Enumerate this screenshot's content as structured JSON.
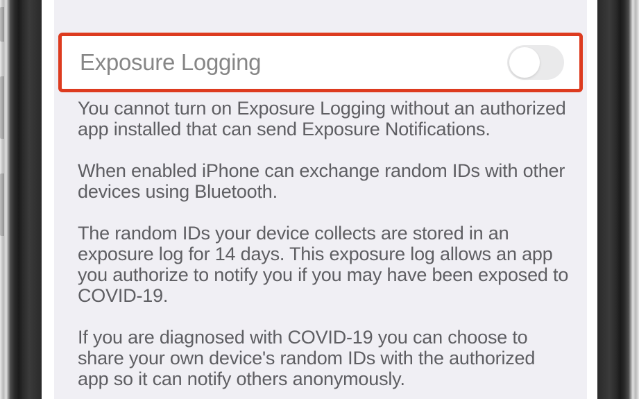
{
  "setting": {
    "label": "Exposure Logging",
    "toggle_state": "off"
  },
  "description": {
    "p1": "You cannot turn on Exposure Logging without an authorized app installed that can send Exposure Notifications.",
    "p2": "When enabled iPhone can exchange random IDs with other devices using Bluetooth.",
    "p3": "The random IDs your device collects are stored in an exposure log for 14 days. This exposure log allows an app you authorize to notify you if you may have been exposed to COVID-19.",
    "p4": "If you are diagnosed with COVID-19 you can choose to share your own device's random IDs with the authorized app so it can notify others anonymously."
  },
  "highlight_color": "#dd3b1f"
}
